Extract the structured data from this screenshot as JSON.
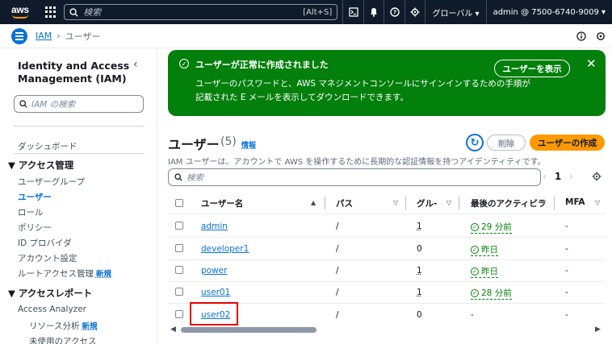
{
  "topbar": {
    "logo_text": "aws",
    "search_placeholder": "検索",
    "search_shortcut": "[Alt+S]",
    "region": "グローバル ▾",
    "account": "admin @ 7500-6740-9009 ▾"
  },
  "breadcrumb": {
    "service": "IAM",
    "current": "ユーザー"
  },
  "sidebar": {
    "title": "Identity and Access Management (IAM)",
    "search_placeholder": "IAM の検索",
    "dashboard": "ダッシュボード",
    "section_access": "▼ アクセス管理",
    "items_access": [
      {
        "label": "ユーザーグループ"
      },
      {
        "label": "ユーザー"
      },
      {
        "label": "ロール"
      },
      {
        "label": "ポリシー"
      },
      {
        "label": "ID プロバイダ"
      },
      {
        "label": "アカウント設定"
      },
      {
        "label": "ルートアクセス管理",
        "badge": "新規"
      }
    ],
    "section_reports": "▼ アクセスレポート",
    "items_reports": [
      {
        "label": "Access Analyzer"
      },
      {
        "label": "リソース分析",
        "badge": "新規"
      },
      {
        "label": "未使用のアクセス"
      }
    ]
  },
  "flash": {
    "heading": "ユーザーが正常に作成されました",
    "body_line1": "ユーザーのパスワードと、AWS マネジメントコンソールにサインインするための手順が",
    "body_line2": "記載された E メールを表示してダウンロードできます。",
    "view_button": "ユーザーを表示"
  },
  "header": {
    "title": "ユーザー",
    "count": "(5)",
    "info": "情報",
    "delete": "削除",
    "create": "ユーザーの作成",
    "description": "IAM ユーザーは、アカウントで AWS を操作するために長期的な認証情報を持つアイデンティティです。"
  },
  "table": {
    "search_placeholder": "検索",
    "page": "1",
    "columns": [
      "ユーザー名",
      "パス",
      "グル-",
      "最後のアクティビラ",
      "MFA"
    ],
    "rows": [
      {
        "name": "admin",
        "path": "/",
        "groups": "1",
        "activity": "29 分前",
        "mfa": "-"
      },
      {
        "name": "developer1",
        "path": "/",
        "groups": "0",
        "activity": "昨日",
        "mfa": "-"
      },
      {
        "name": "power",
        "path": "/",
        "groups": "1",
        "activity": "昨日",
        "mfa": "-"
      },
      {
        "name": "user01",
        "path": "/",
        "groups": "1",
        "activity": "28 分前",
        "mfa": "-"
      },
      {
        "name": "user02",
        "path": "/",
        "groups": "0",
        "activity": "-",
        "mfa": "-"
      }
    ]
  },
  "colors": {
    "topbar": "#0f1b2a",
    "link": "#0972d3",
    "success": "#037f0c",
    "primary_button": "#ff9900",
    "highlight": "#e30000"
  }
}
